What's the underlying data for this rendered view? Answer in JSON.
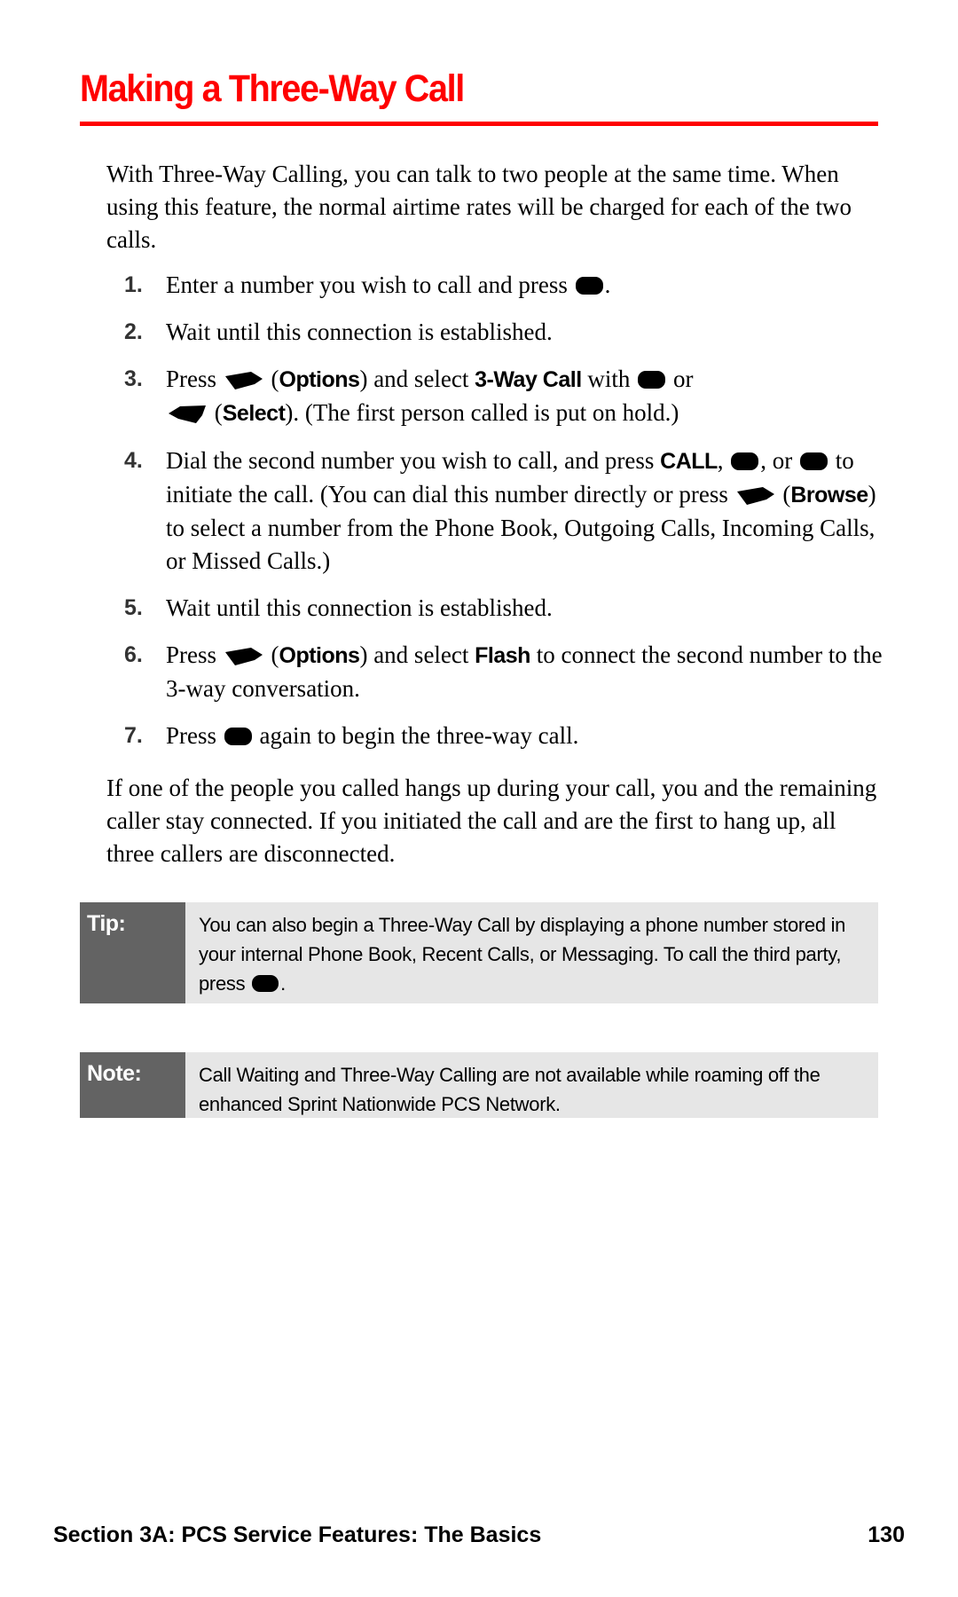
{
  "page": {
    "title": "Making a Three-Way Call",
    "accent_color": "#ff0000",
    "intro": "With Three-Way Calling, you can talk to two people at the same time. When using this feature, the normal airtime rates will be charged for each of the two calls.",
    "steps": [
      {
        "num": "1.",
        "t1": "Enter a number you wish to call and press",
        "t2": "."
      },
      {
        "num": "2.",
        "t1": "Wait until this connection is established."
      },
      {
        "num": "3.",
        "t1": "Press",
        "b1": "Options",
        "t2": "and select",
        "b2": "3-Way Call",
        "t3": "with",
        "t4": "or",
        "b3": "Select",
        "t5": ". (The first person called is put on hold.)"
      },
      {
        "num": "4.",
        "t1": "Dial the second number you wish to call, and press",
        "b1": "CALL",
        "t2": "or",
        "t3": "to initiate the call. (You can dial this number directly or press",
        "b2": "Browse",
        "t4": ") to select a number from the Phone Book, Outgoing Calls, Incoming Calls, or Missed Calls.)"
      },
      {
        "num": "5.",
        "t1": "Wait until this connection is established."
      },
      {
        "num": "6.",
        "t1": "Press",
        "b1": "Options",
        "t2": "and select",
        "b2": "Flash",
        "t3": "to connect the second number to the 3-way conversation."
      },
      {
        "num": "7.",
        "t1": "Press",
        "t2": "again to begin the three-way call."
      }
    ],
    "outro": "If one of the people you called hangs up during your call, you and the remaining caller stay connected. If you initiated the call and are the first to hang up, all three callers are disconnected.",
    "tip": {
      "label": "Tip:",
      "text": "You can also begin a Three-Way Call by displaying a phone number stored in your internal Phone Book, Recent Calls, or Messaging. To call the third party, press",
      "end": "."
    },
    "note": {
      "label": "Note:",
      "text": "Call Waiting and Three-Way Calling are not available while roaming off the enhanced Sprint Nationwide PCS Network."
    },
    "footer": {
      "section": "Section 3A: PCS Service Features: The Basics",
      "page_number": "130"
    },
    "icons": {
      "talk_key": "talk-key-icon",
      "right_softkey": "right-softkey-icon",
      "left_softkey": "left-softkey-icon"
    }
  }
}
